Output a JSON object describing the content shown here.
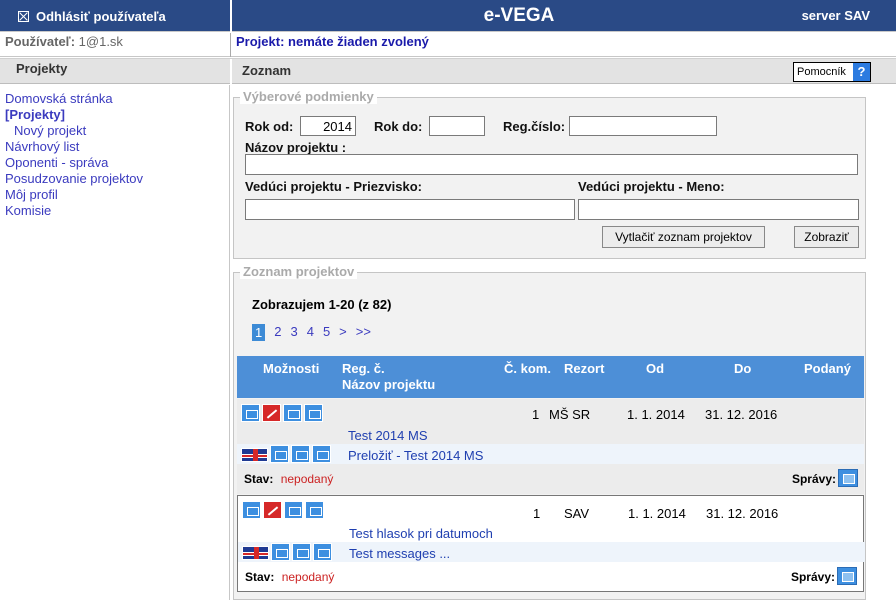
{
  "header": {
    "logout_label": "Odhlásiť používateľa",
    "app_title": "e-VEGA",
    "server_label": "server SAV",
    "bg_color": "#2a4a86"
  },
  "user_row": {
    "user_label": "Používateľ:",
    "user_value": "1@1.sk",
    "project_label": "Projekt:",
    "project_value": "nemáte žiaden zvolený"
  },
  "section_bar": {
    "left_title": "Projekty",
    "right_title": "Zoznam",
    "help_label": "Pomocník",
    "help_icon": "?"
  },
  "sidebar": {
    "items": [
      {
        "label": "Domovská stránka"
      },
      {
        "label": "[Projekty]"
      },
      {
        "label": "Nový projekt"
      },
      {
        "label": "Návrhový list"
      },
      {
        "label": "Oponenti - správa"
      },
      {
        "label": "Posudzovanie projektov"
      },
      {
        "label": "Môj profil"
      },
      {
        "label": "Komisie"
      }
    ]
  },
  "filters": {
    "legend": "Výberové podmienky",
    "rok_od_label": "Rok od:",
    "rok_od_value": "2014",
    "rok_do_label": "Rok do:",
    "rok_do_value": "",
    "reg_label": "Reg.číslo:",
    "reg_value": "",
    "nazov_label": "Názov projektu :",
    "nazov_value": "",
    "priezvisko_label": "Vedúci projektu - Priezvisko:",
    "priezvisko_value": "",
    "meno_label": "Vedúci projektu - Meno:",
    "meno_value": "",
    "print_button": "Vytlačiť zoznam projektov",
    "show_button": "Zobraziť"
  },
  "list": {
    "legend": "Zoznam projektov",
    "showing": "Zobrazujem 1-20 (z 82)",
    "pager": [
      "1",
      "2",
      "3",
      "4",
      "5",
      ">",
      ">>"
    ],
    "columns": {
      "moznosti": "Možnosti",
      "reg": "Reg. č.",
      "nazov": "Názov projektu",
      "kom": "Č. kom.",
      "rezort": "Rezort",
      "od": "Od",
      "do": "Do",
      "podany": "Podaný"
    },
    "header_color": "#4d8fd7",
    "rows": [
      {
        "kom": "1",
        "rezort": "MŠ SR",
        "od": "1. 1. 2014",
        "do": "31. 12. 2016",
        "title": "Test 2014 MS",
        "translate": "Preložiť - Test 2014 MS",
        "stav_label": "Stav:",
        "stav_value": "nepodaný",
        "spravy_label": "Správy:"
      },
      {
        "kom": "1",
        "rezort": "SAV",
        "od": "1. 1. 2014",
        "do": "31. 12. 2016",
        "title": "Test hlasok pri datumoch",
        "translate": "Test messages ...",
        "stav_label": "Stav:",
        "stav_value": "nepodaný",
        "spravy_label": "Správy:"
      }
    ]
  }
}
